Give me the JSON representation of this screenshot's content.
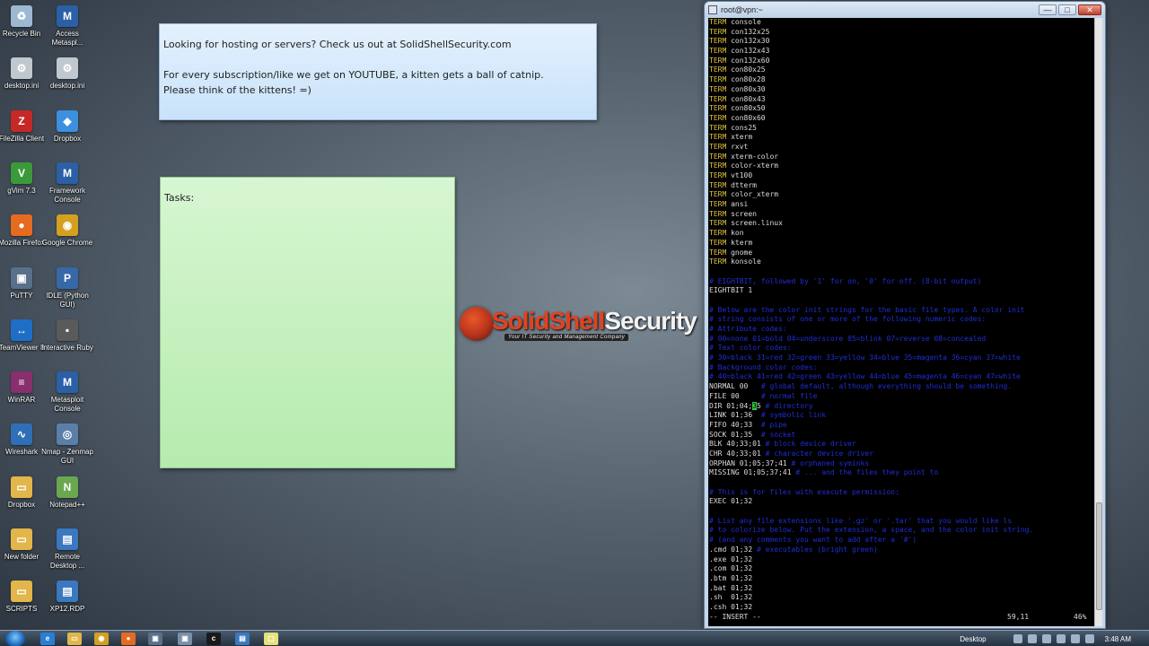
{
  "desktop_icons": [
    {
      "label": "Recycle Bin",
      "icon": "recycle-bin-icon",
      "color": "#9db8d0",
      "glyph": "♻"
    },
    {
      "label": "Access Metaspl...",
      "icon": "metasploit-icon",
      "color": "#2b5fa6",
      "glyph": "M"
    },
    {
      "label": "desktop.ini",
      "icon": "settings-file-icon",
      "color": "#bfc7cf",
      "glyph": "⚙"
    },
    {
      "label": "desktop.ini",
      "icon": "settings-file-icon",
      "color": "#bfc7cf",
      "glyph": "⚙"
    },
    {
      "label": "FileZilla Client",
      "icon": "filezilla-icon",
      "color": "#c62828",
      "glyph": "Z"
    },
    {
      "label": "Dropbox",
      "icon": "dropbox-icon",
      "color": "#3d8fe0",
      "glyph": "◆"
    },
    {
      "label": "gVim 7.3",
      "icon": "gvim-icon",
      "color": "#3a9a3a",
      "glyph": "V"
    },
    {
      "label": "Framework Console",
      "icon": "metasploit-icon",
      "color": "#2b5fa6",
      "glyph": "M"
    },
    {
      "label": "Mozilla Firefox",
      "icon": "firefox-icon",
      "color": "#e66a1f",
      "glyph": "●"
    },
    {
      "label": "Google Chrome",
      "icon": "chrome-icon",
      "color": "#d4a020",
      "glyph": "◉"
    },
    {
      "label": "PuTTY",
      "icon": "putty-icon",
      "color": "#5a6f8a",
      "glyph": "▣"
    },
    {
      "label": "IDLE (Python GUI)",
      "icon": "python-icon",
      "color": "#3768a8",
      "glyph": "P"
    },
    {
      "label": "TeamViewer 8",
      "icon": "teamviewer-icon",
      "color": "#1f6ec6",
      "glyph": "↔"
    },
    {
      "label": "Interactive Ruby",
      "icon": "ruby-icon",
      "color": "#5a5a5a",
      "glyph": "▪"
    },
    {
      "label": "WinRAR",
      "icon": "winrar-icon",
      "color": "#8a2f6d",
      "glyph": "≡"
    },
    {
      "label": "Metasploit Console",
      "icon": "metasploit-icon",
      "color": "#2b5fa6",
      "glyph": "M"
    },
    {
      "label": "Wireshark",
      "icon": "wireshark-icon",
      "color": "#2f6fb8",
      "glyph": "∿"
    },
    {
      "label": "Nmap - Zenmap GUI",
      "icon": "nmap-icon",
      "color": "#5a7fa8",
      "glyph": "◎"
    },
    {
      "label": "Dropbox",
      "icon": "folder-icon",
      "color": "#e2b64a",
      "glyph": "▭"
    },
    {
      "label": "Notepad++",
      "icon": "notepad-plus-plus-icon",
      "color": "#6aa84f",
      "glyph": "N"
    },
    {
      "label": "New folder",
      "icon": "folder-icon",
      "color": "#e2b64a",
      "glyph": "▭"
    },
    {
      "label": "Remote Desktop ...",
      "icon": "remote-desktop-icon",
      "color": "#3a78c0",
      "glyph": "▤"
    },
    {
      "label": "SCRIPTS",
      "icon": "folder-icon",
      "color": "#e2b64a",
      "glyph": "▭"
    },
    {
      "label": "XP12.RDP",
      "icon": "remote-desktop-icon",
      "color": "#3a78c0",
      "glyph": "▤"
    }
  ],
  "notes": {
    "blue": "Looking for hosting or servers? Check us out at SolidShellSecurity.com\n\nFor every subscription/like we get on YOUTUBE, a kitten gets a ball of catnip.\nPlease think of the kittens! =)",
    "green": "Tasks:"
  },
  "logo": {
    "name_a": "SolidShell",
    "name_b": "Security",
    "tagline": "Your IT Security and Management Company"
  },
  "terminal": {
    "title": "root@vpn:~",
    "controls": {
      "minimize": "—",
      "maximize": "□",
      "close": "✕"
    },
    "term_lines": [
      "console",
      "con132x25",
      "con132x30",
      "con132x43",
      "con132x60",
      "con80x25",
      "con80x28",
      "con80x30",
      "con80x43",
      "con80x50",
      "con80x60",
      "cons25",
      "xterm",
      "rxvt",
      "xterm-color",
      "color-xterm",
      "vt100",
      "dtterm",
      "color_xterm",
      "ansi",
      "screen",
      "screen.linux",
      "kon",
      "kterm",
      "gnome",
      "konsole"
    ],
    "term_keyword": "TERM",
    "eightbit_comment": "# EIGHTBIT, followed by '1' for on, '0' for off. (8-bit output)",
    "eightbit": "EIGHTBIT 1",
    "color_comments": [
      "# Below are the color init strings for the basic file types. A color init",
      "# string consists of one or more of the following numeric codes:",
      "# Attribute codes:",
      "# 00=none 01=bold 04=underscore 05=blink 07=reverse 08=concealed",
      "# Text color codes:",
      "# 30=black 31=red 32=green 33=yellow 34=blue 35=magenta 36=cyan 37=white",
      "# Background color codes:",
      "# 40=black 41=red 42=green 43=yellow 44=blue 45=magenta 46=cyan 47=white"
    ],
    "file_types": [
      {
        "code": "NORMAL 00",
        "comment": "# global default, although everything should be something."
      },
      {
        "code": "FILE 00",
        "comment": "# normal file"
      },
      {
        "code": "DIR 01;04;",
        "cursor_char": "3",
        "after_cursor": "5",
        "comment": "# directory"
      },
      {
        "code": "LINK 01;36",
        "comment": "# symbolic link"
      },
      {
        "code": "FIFO 40;33",
        "comment": "# pipe"
      },
      {
        "code": "SOCK 01;35",
        "comment": "# socket"
      },
      {
        "code": "BLK 40;33;01",
        "comment": "# block device driver"
      },
      {
        "code": "CHR 40;33;01",
        "comment": "# character device driver"
      },
      {
        "code": "ORPHAN 01;05;37;41",
        "comment": "# orphaned syminks"
      },
      {
        "code": "MISSING 01;05;37;41",
        "comment": "# ... and the files they point to"
      }
    ],
    "exec_comment": "# This is for files with execute permission:",
    "exec": "EXEC 01;32",
    "ext_comments": [
      "# List any file extensions like '.gz' or '.tar' that you would like ls",
      "# to colorize below. Put the extension, a space, and the color init string.",
      "# (and any comments you want to add after a '#')"
    ],
    "extensions": [
      {
        "code": ".cmd 01;32",
        "comment": "# executables (bright green)"
      },
      {
        "code": ".exe 01;32",
        "comment": ""
      },
      {
        "code": ".com 01;32",
        "comment": ""
      },
      {
        "code": ".btm 01;32",
        "comment": ""
      },
      {
        "code": ".bat 01;32",
        "comment": ""
      },
      {
        "code": ".sh  01;32",
        "comment": ""
      },
      {
        "code": ".csh 01;32",
        "comment": ""
      }
    ],
    "mode": "-- INSERT --",
    "cursor_pos": "59,11",
    "scroll_pct": "46%"
  },
  "taskbar": {
    "items": [
      {
        "icon": "internet-explorer-icon",
        "color": "#2a7fd4",
        "glyph": "e"
      },
      {
        "icon": "folder-icon",
        "color": "#e2b64a",
        "glyph": "▭"
      },
      {
        "icon": "chrome-icon",
        "color": "#d4a020",
        "glyph": "◉"
      },
      {
        "icon": "firefox-icon",
        "color": "#e66a1f",
        "glyph": "●"
      },
      {
        "icon": "putty-icon",
        "color": "#5a6f8a",
        "glyph": "▣"
      },
      {
        "icon": "putty-icon",
        "color": "#7a8fa8",
        "glyph": "▣"
      },
      {
        "icon": "cmd-icon",
        "color": "#1a1a1a",
        "glyph": "c"
      },
      {
        "icon": "remote-desktop-icon",
        "color": "#3a78c0",
        "glyph": "▤"
      },
      {
        "icon": "sticky-notes-icon",
        "color": "#e6e27a",
        "glyph": "▢"
      }
    ],
    "desktop_label": "Desktop",
    "clock": "3:48 AM"
  }
}
